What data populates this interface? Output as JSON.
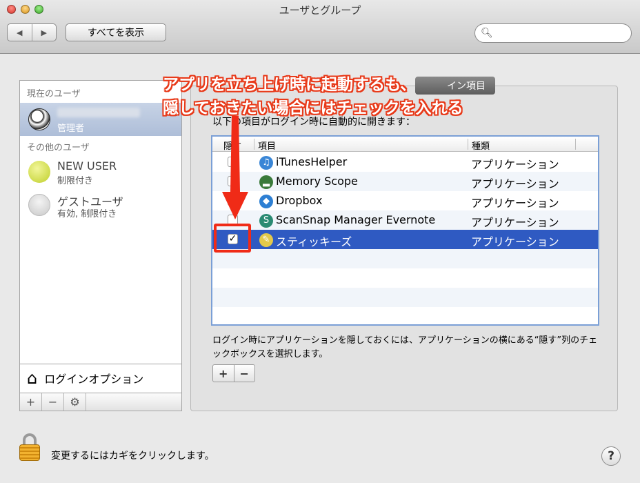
{
  "window": {
    "title": "ユーザとグループ"
  },
  "toolbar": {
    "show_all": "すべてを表示",
    "search_placeholder": ""
  },
  "sidebar": {
    "current_users_header": "現在のユーザ",
    "current_user_role": "管理者",
    "other_users_header": "その他のユーザ",
    "other_users": [
      {
        "name": "NEW USER",
        "sub": "制限付き"
      },
      {
        "name": "ゲストユーザ",
        "sub": "有効, 制限付き"
      }
    ],
    "login_options": "ログインオプション"
  },
  "panel": {
    "tab_label": "イン項目",
    "description": "以下の項目がログイン時に自動的に開きます：",
    "columns": {
      "hide": "隠す",
      "item": "項目",
      "kind": "種類"
    },
    "rows": [
      {
        "name": "iTunesHelper",
        "kind": "アプリケーション",
        "hidden": false,
        "icon": "itunes-icon",
        "icon_color": "#3a86d6",
        "glyph": "♫"
      },
      {
        "name": "Memory Scope",
        "kind": "アプリケーション",
        "hidden": false,
        "icon": "memory-scope-icon",
        "icon_color": "#3a7a3a",
        "glyph": "▂"
      },
      {
        "name": "Dropbox",
        "kind": "アプリケーション",
        "hidden": false,
        "icon": "dropbox-icon",
        "icon_color": "#2d7fd3",
        "glyph": "◆"
      },
      {
        "name": "ScanSnap Manager Evernote",
        "kind": "アプリケーション",
        "hidden": false,
        "icon": "scansnap-icon",
        "icon_color": "#2a8a72",
        "glyph": "S"
      },
      {
        "name": "スティッキーズ",
        "kind": "アプリケーション",
        "hidden": true,
        "icon": "stickies-icon",
        "icon_color": "#e3c94b",
        "glyph": "✎",
        "selected": true
      }
    ],
    "help_text": "ログイン時にアプリケーションを隠しておくには、アプリケーションの横にある“隠す”列のチェックボックスを選択します。",
    "add_label": "+",
    "remove_label": "−"
  },
  "bottom": {
    "lock_text": "変更するにはカギをクリックします。",
    "help_label": "?"
  },
  "annotation": {
    "line1": "アプリを立ち上げ時に起動するも、",
    "line2": "隠しておきたい場合にはチェックを入れる",
    "color": "#e83a1a"
  }
}
